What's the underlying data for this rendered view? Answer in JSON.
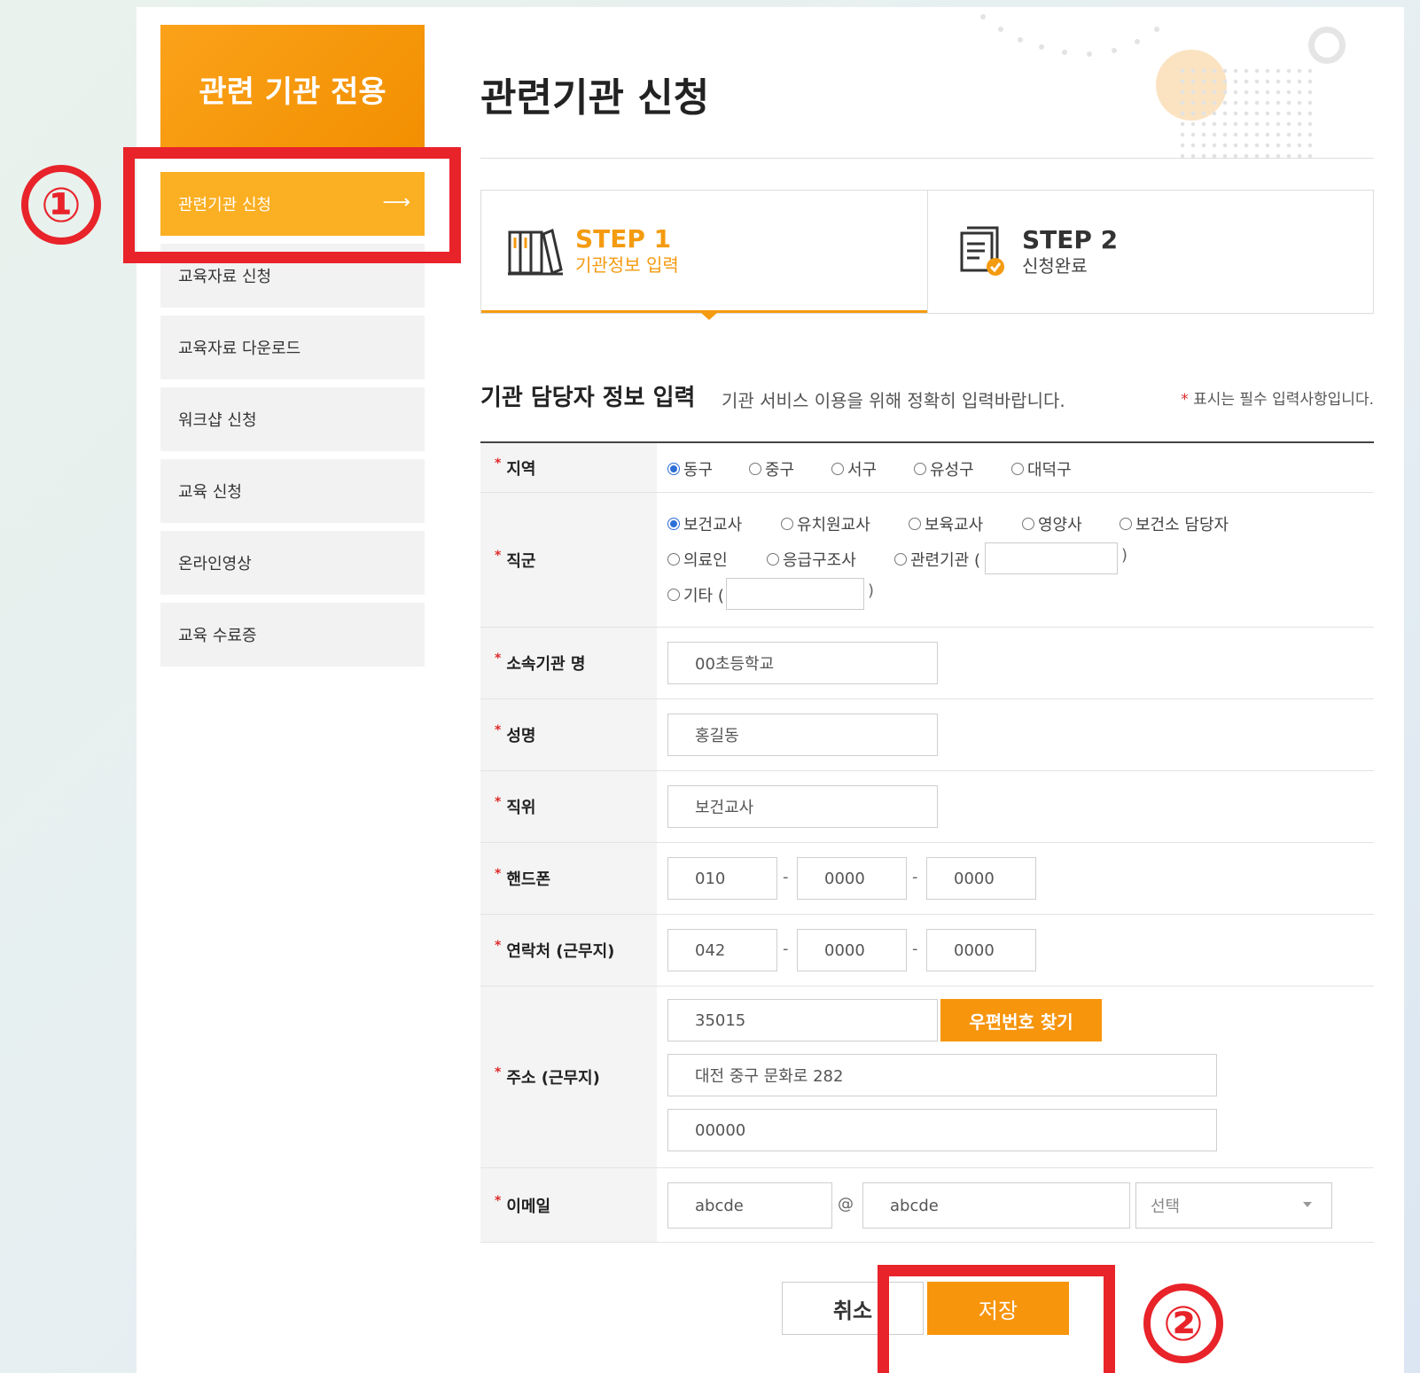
{
  "sidebar": {
    "header": "관련 기관 전용",
    "items": [
      {
        "label": "관련기관 신청",
        "active": true,
        "arrow": "⟶"
      },
      {
        "label": "교육자료 신청"
      },
      {
        "label": "교육자료 다운로드"
      },
      {
        "label": "워크샵 신청"
      },
      {
        "label": "교육 신청"
      },
      {
        "label": "온라인영상"
      },
      {
        "label": "교육 수료증"
      }
    ]
  },
  "page_title": "관련기관 신청",
  "steps": [
    {
      "num": "STEP 1",
      "label": "기관정보 입력",
      "icon": "books-icon",
      "active": true
    },
    {
      "num": "STEP 2",
      "label": "신청완료",
      "icon": "document-check-icon"
    }
  ],
  "section": {
    "title": "기관 담당자 정보 입력",
    "desc": "기관 서비스 이용을 위해 정확히 입력바랍니다.",
    "note_star": "*",
    "note": "표시는 필수 입력사항입니다."
  },
  "form": {
    "required_mark": "*",
    "region": {
      "label": "지역",
      "options": [
        "동구",
        "중구",
        "서구",
        "유성구",
        "대덕구"
      ],
      "selected": "동구"
    },
    "job": {
      "label": "직군",
      "options": [
        "보건교사",
        "유치원교사",
        "보육교사",
        "영양사",
        "보건소 담당자",
        "의료인",
        "응급구조사",
        "관련기관 (",
        "기타 ("
      ],
      "close_paren": ")",
      "selected": "보건교사"
    },
    "org": {
      "label": "소속기관 명",
      "value": "00초등학교"
    },
    "name": {
      "label": "성명",
      "value": "홍길동"
    },
    "position": {
      "label": "직위",
      "value": "보건교사"
    },
    "mobile": {
      "label": "핸드폰",
      "parts": [
        "010",
        "0000",
        "0000"
      ],
      "sep": "-"
    },
    "phone": {
      "label": "연락처 (근무지)",
      "parts": [
        "042",
        "0000",
        "0000"
      ],
      "sep": "-"
    },
    "address": {
      "label": "주소 (근무지)",
      "zip": "35015",
      "zip_button": "우편번호 찾기",
      "line1": "대전 중구 문화로 282",
      "line2": "00000"
    },
    "email": {
      "label": "이메일",
      "local": "abcde",
      "at": "@",
      "domain": "abcde",
      "select": "선택"
    }
  },
  "buttons": {
    "cancel": "취소",
    "save": "저장"
  },
  "annotations": {
    "one": "①",
    "two": "②",
    "color": "#e8232a"
  },
  "colors": {
    "accent": "#f7950d",
    "radio": "#2d6fd6"
  }
}
